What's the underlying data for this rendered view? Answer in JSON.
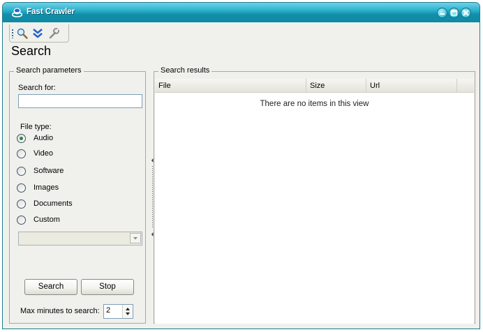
{
  "window": {
    "title": "Fast Crawler"
  },
  "toolbar": {
    "tools": [
      "search-icon",
      "double-chevron-down-icon",
      "wrench-icon"
    ]
  },
  "page": {
    "title": "Search"
  },
  "params": {
    "legend": "Search parameters",
    "search_for_label": "Search for:",
    "search_for_value": "",
    "file_type_label": "File type:",
    "file_types": [
      {
        "label": "Audio",
        "selected": true
      },
      {
        "label": "Video",
        "selected": false
      },
      {
        "label": "Software",
        "selected": false
      },
      {
        "label": "Images",
        "selected": false
      },
      {
        "label": "Documents",
        "selected": false
      },
      {
        "label": "Custom",
        "selected": false
      }
    ],
    "custom_combo_value": "",
    "search_button": "Search",
    "stop_button": "Stop",
    "max_minutes_label": "Max minutes to search:",
    "max_minutes_value": "2"
  },
  "results": {
    "legend": "Search results",
    "columns": [
      "File",
      "Size",
      "Url"
    ],
    "empty_message": "There are no items in this view"
  },
  "colors": {
    "titlebar": "#138ea9",
    "selected_radio": "#2a8a3a"
  }
}
